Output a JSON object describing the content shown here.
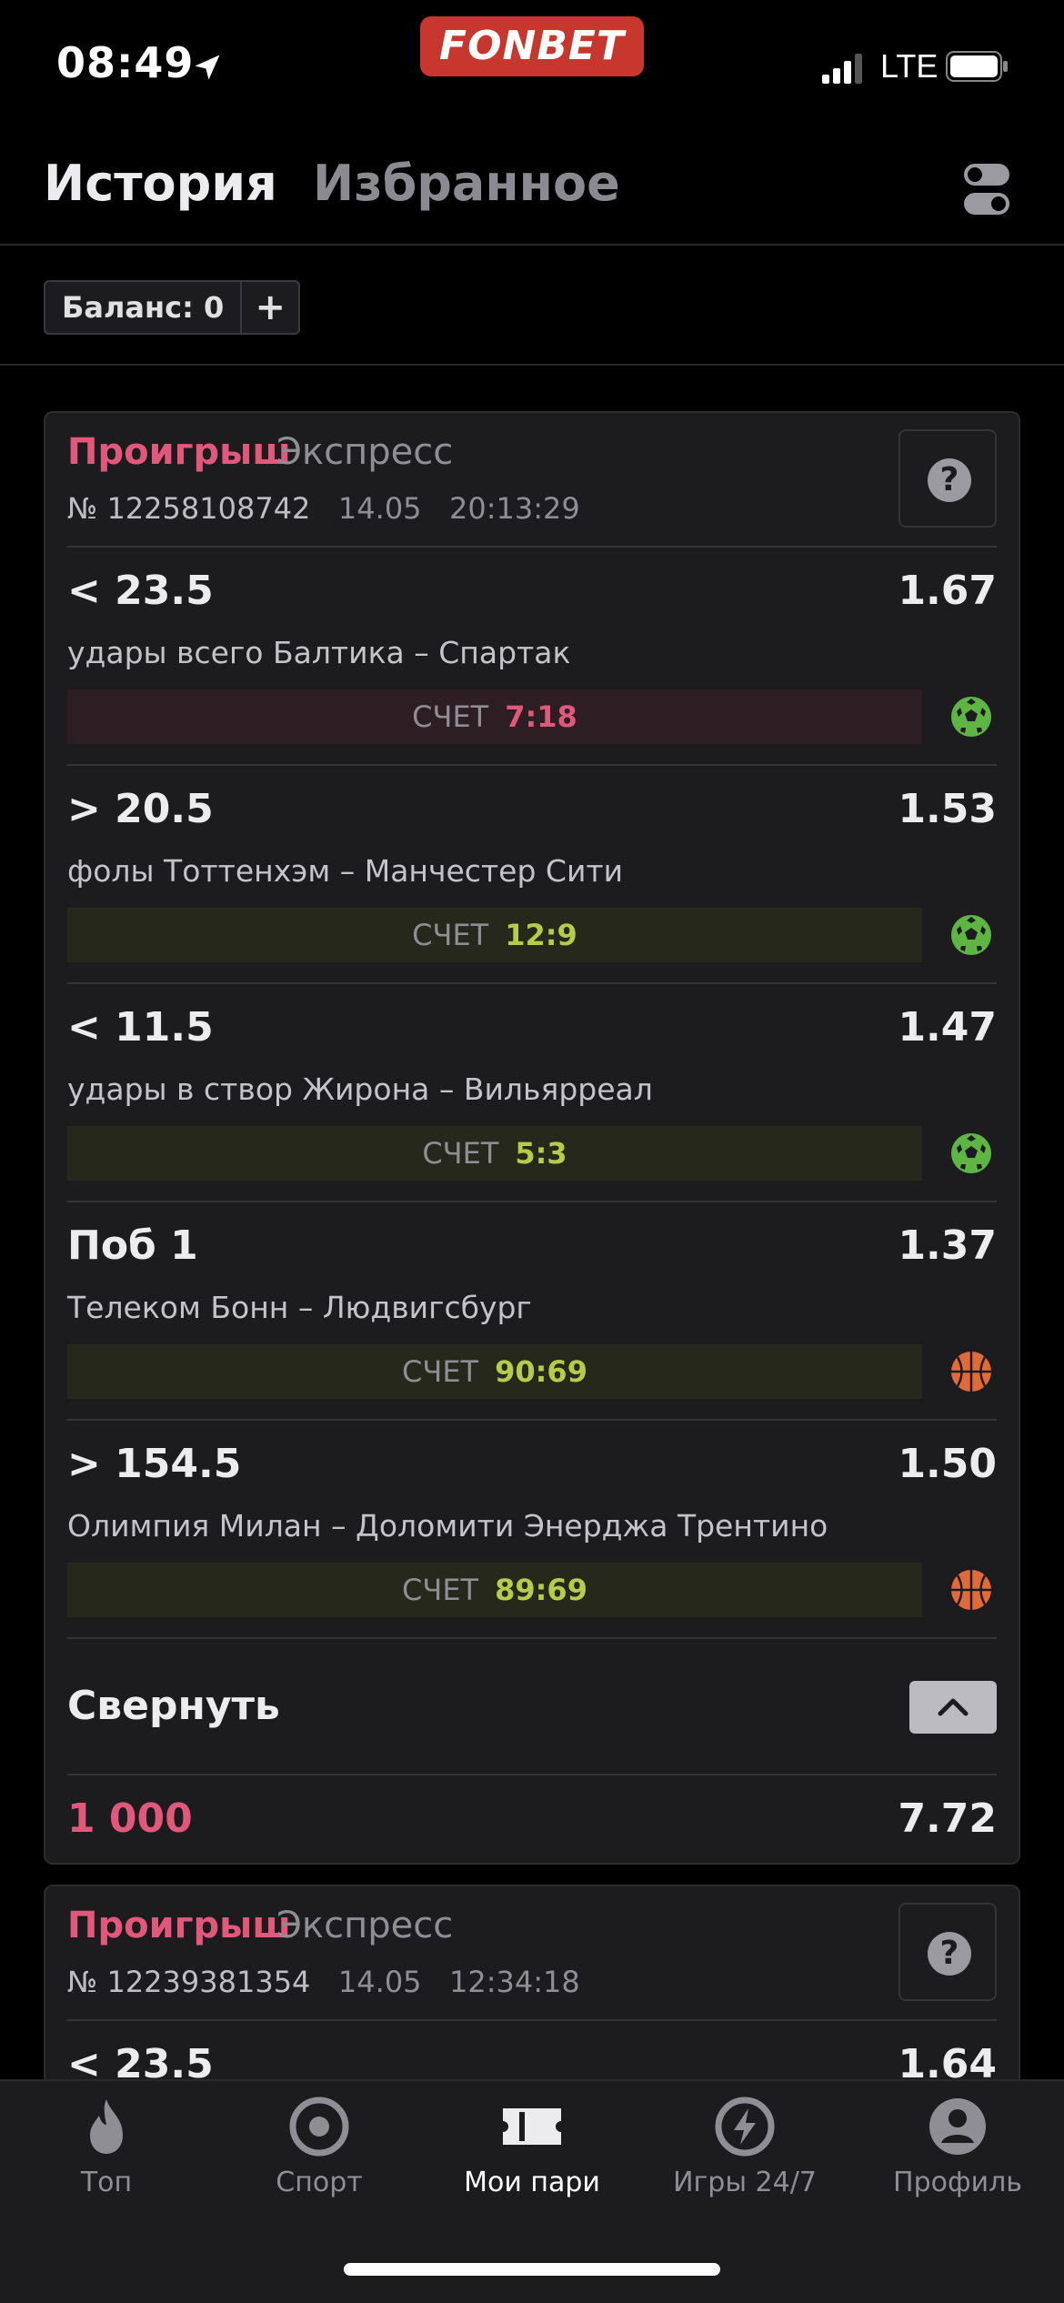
{
  "status_bar": {
    "time": "08:49",
    "network": "LTE"
  },
  "brand": {
    "name": "FONBET",
    "color": "#c8372d"
  },
  "tabs": [
    {
      "label": "История",
      "active": true
    },
    {
      "label": "Избранное",
      "active": false
    }
  ],
  "balance": {
    "label": "Баланс: 0",
    "add_label": "+"
  },
  "bets": [
    {
      "status": "Проигрыш",
      "type": "Экспресс",
      "number": "№ 12258108742",
      "date": "14.05",
      "time": "20:13:29",
      "help_label": "?",
      "legs": [
        {
          "pick": "< 23.5",
          "odds": "1.67",
          "event": "удары всего Балтика – Спартак",
          "score_label": "СЧЕТ",
          "score": "7:18",
          "result": "lost",
          "sport": "football-icon"
        },
        {
          "pick": "> 20.5",
          "odds": "1.53",
          "event": "фолы Тоттенхэм – Манчестер Сити",
          "score_label": "СЧЕТ",
          "score": "12:9",
          "result": "won",
          "sport": "football-icon"
        },
        {
          "pick": "< 11.5",
          "odds": "1.47",
          "event": "удары в створ Жирона – Вильярреал",
          "score_label": "СЧЕТ",
          "score": "5:3",
          "result": "won",
          "sport": "football-icon"
        },
        {
          "pick": "Поб 1",
          "odds": "1.37",
          "event": "Телеком Бонн – Людвигсбург",
          "score_label": "СЧЕТ",
          "score": "90:69",
          "result": "won",
          "sport": "basketball-icon"
        },
        {
          "pick": "> 154.5",
          "odds": "1.50",
          "event": "Олимпия Милан – Доломити Энерджа Трентино",
          "score_label": "СЧЕТ",
          "score": "89:69",
          "result": "won",
          "sport": "basketball-icon"
        }
      ],
      "collapse_label": "Свернуть",
      "stake": "1 000",
      "total_odds": "7.72"
    },
    {
      "status": "Проигрыш",
      "type": "Экспресс",
      "number": "№ 12239381354",
      "date": "14.05",
      "time": "12:34:18",
      "help_label": "?",
      "legs": [
        {
          "pick": "< 23.5",
          "odds": "1.64"
        }
      ]
    }
  ],
  "bottom_nav": [
    {
      "label": "Топ",
      "icon": "flame-icon",
      "active": false
    },
    {
      "label": "Спорт",
      "icon": "target-icon",
      "active": false
    },
    {
      "label": "Мои пари",
      "icon": "ticket-icon",
      "active": true
    },
    {
      "label": "Игры 24/7",
      "icon": "lightning-icon",
      "active": false
    },
    {
      "label": "Профиль",
      "icon": "profile-icon",
      "active": false
    }
  ],
  "colors": {
    "lost": "#e2587a",
    "won": "#b4cc4a",
    "background": "#000000",
    "card": "#1c1c1e"
  }
}
